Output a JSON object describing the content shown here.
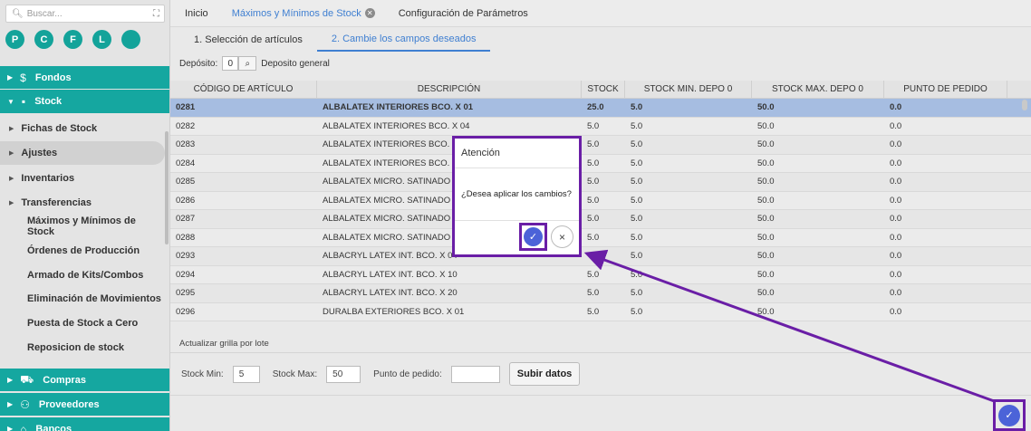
{
  "sidebar": {
    "search_placeholder": "Buscar...",
    "expand_icon": "⛶",
    "circles": [
      "P",
      "C",
      "F",
      "L",
      ""
    ],
    "bands": {
      "fondos": "Fondos",
      "stock": "Stock",
      "compras": "Compras",
      "proveedores": "Proveedores",
      "bancos": "Bancos"
    },
    "items": [
      {
        "label": "Fichas de Stock",
        "arrow": true
      },
      {
        "label": "Ajustes",
        "arrow": true,
        "active": true
      },
      {
        "label": "Inventarios",
        "arrow": true
      },
      {
        "label": "Transferencias",
        "arrow": true
      },
      {
        "label": "Máximos y Mínimos de Stock",
        "arrow": false
      },
      {
        "label": "Órdenes de Producción",
        "arrow": false
      },
      {
        "label": "Armado de Kits/Combos",
        "arrow": false
      },
      {
        "label": "Eliminación de Movimientos",
        "arrow": false
      },
      {
        "label": "Puesta de Stock a Cero",
        "arrow": false
      },
      {
        "label": "Reposicion de stock",
        "arrow": false
      }
    ]
  },
  "tabs": {
    "inicio": "Inicio",
    "maxmin": "Máximos y Mínimos de Stock",
    "config": "Configuración de Parámetros"
  },
  "subtabs": {
    "step1": "1. Selección de artículos",
    "step2": "2. Cambie los campos deseados"
  },
  "deposit": {
    "label": "Depósito:",
    "value": "0",
    "name": "Deposito general"
  },
  "table": {
    "headers": [
      "CÓDIGO DE ARTÍCULO",
      "DESCRIPCIÓN",
      "STOCK",
      "STOCK MIN. DEPO 0",
      "STOCK MAX. DEPO 0",
      "PUNTO DE PEDIDO"
    ],
    "rows": [
      [
        "0281",
        "ALBALATEX INTERIORES BCO. X 01",
        "25.0",
        "5.0",
        "50.0",
        "0.0"
      ],
      [
        "0282",
        "ALBALATEX INTERIORES BCO. X 04",
        "5.0",
        "5.0",
        "50.0",
        "0.0"
      ],
      [
        "0283",
        "ALBALATEX INTERIORES BCO. X 1",
        "5.0",
        "5.0",
        "50.0",
        "0.0"
      ],
      [
        "0284",
        "ALBALATEX INTERIORES BCO. X 2",
        "5.0",
        "5.0",
        "50.0",
        "0.0"
      ],
      [
        "0285",
        "ALBALATEX MICRO. SATINADO BC",
        "5.0",
        "5.0",
        "50.0",
        "0.0"
      ],
      [
        "0286",
        "ALBALATEX MICRO. SATINADO BC",
        "5.0",
        "5.0",
        "50.0",
        "0.0"
      ],
      [
        "0287",
        "ALBALATEX MICRO. SATINADO BC",
        "5.0",
        "5.0",
        "50.0",
        "0.0"
      ],
      [
        "0288",
        "ALBALATEX MICRO. SATINADO BC",
        "5.0",
        "5.0",
        "50.0",
        "0.0"
      ],
      [
        "0293",
        "ALBACRYL LATEX INT. BCO. X 04",
        "",
        "5.0",
        "50.0",
        "0.0"
      ],
      [
        "0294",
        "ALBACRYL LATEX INT. BCO. X 10",
        "5.0",
        "5.0",
        "50.0",
        "0.0"
      ],
      [
        "0295",
        "ALBACRYL LATEX INT. BCO. X 20",
        "5.0",
        "5.0",
        "50.0",
        "0.0"
      ],
      [
        "0296",
        "DURALBA EXTERIORES BCO. X 01",
        "5.0",
        "5.0",
        "50.0",
        "0.0"
      ]
    ],
    "selected_row": 0
  },
  "batch": {
    "title": "Actualizar grilla por lote",
    "stock_min_label": "Stock Min:",
    "stock_min_value": "5",
    "stock_max_label": "Stock Max:",
    "stock_max_value": "50",
    "punto_label": "Punto de pedido:",
    "punto_value": "",
    "submit_label": "Subir datos"
  },
  "dialog": {
    "title": "Atención",
    "message": "¿Desea aplicar los cambios?",
    "confirm_icon": "✓",
    "cancel_icon": "×"
  },
  "corner_button_icon": "✓",
  "colors": {
    "accent_teal": "#15a7a0",
    "selected_row": "#a6bde1",
    "tab_blue": "#3f7fd1",
    "highlight_purple": "#6a1ea6",
    "confirm_blue": "#4b63d8"
  }
}
